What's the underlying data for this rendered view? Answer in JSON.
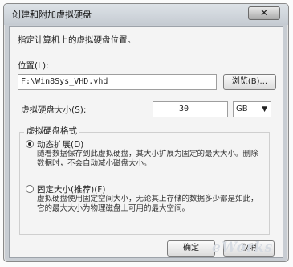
{
  "dialog": {
    "title": "创建和附加虚拟硬盘",
    "close_glyph": "✕"
  },
  "content": {
    "instruction": "指定计算机上的虚拟硬盘位置。",
    "location_label": "位置(L):",
    "location_value": "F:\\Win8Sys_VHD.vhd",
    "browse_label": "浏览(B)...",
    "size_label": "虚拟硬盘大小(S):",
    "size_value": "30",
    "size_unit": "GB",
    "format_heading": "虚拟硬盘格式",
    "dynamic_label": "动态扩展(D)",
    "dynamic_desc": "随着数据保存到此虚拟硬盘，其大小扩展为固定的最大大小。删除数据时，不会自动减小磁盘大小。",
    "dynamic_selected": true,
    "fixed_label": "固定大小(推荐)(F)",
    "fixed_desc": "虚拟硬盘使用固定空间大小，无论其上存储的数据多少都是如此，它的最大大小为物理磁盘上可用的最大空间。",
    "fixed_selected": false
  },
  "footer": {
    "ok_label": "确定",
    "cancel_label": "取消"
  },
  "watermark": "eWorks",
  "icons": {
    "dropdown": "chevron-down-icon",
    "close": "close-icon"
  }
}
